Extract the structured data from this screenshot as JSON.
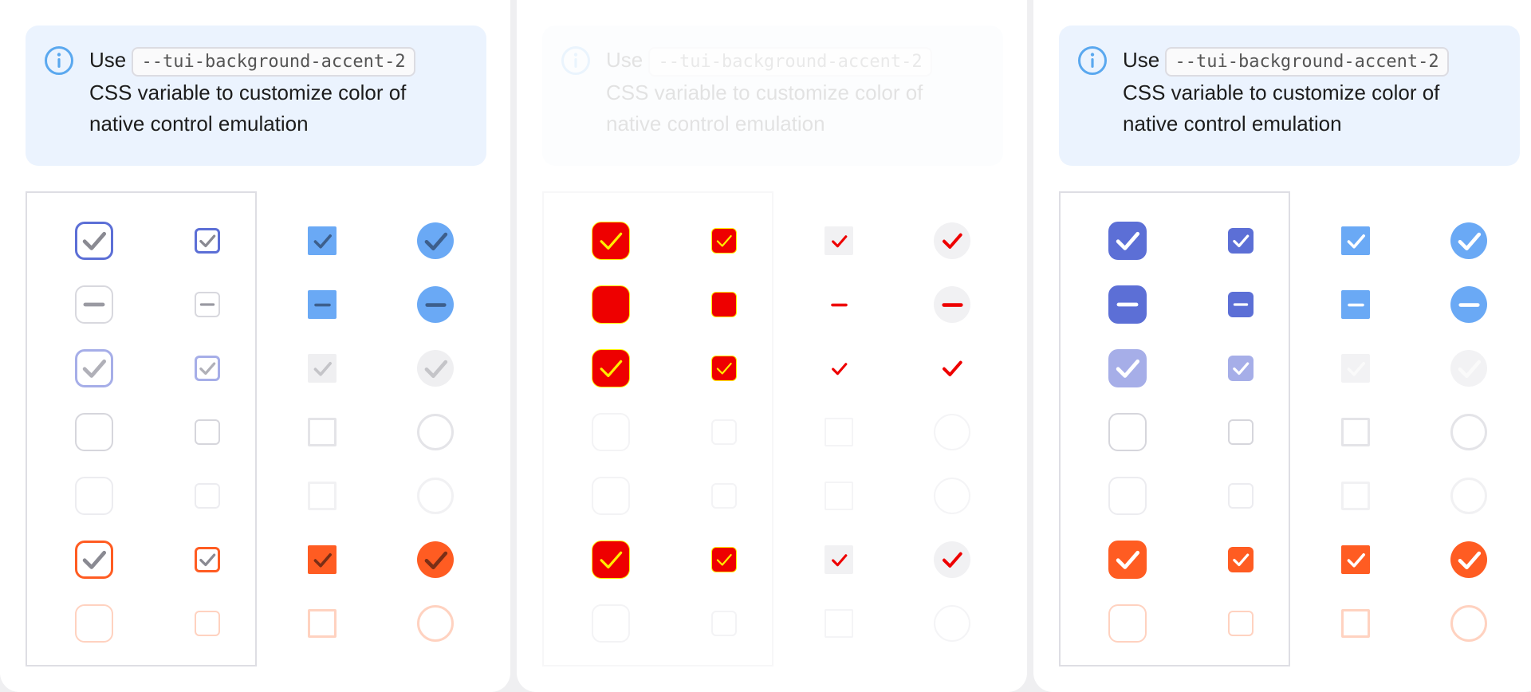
{
  "notice": {
    "prefix": "Use",
    "code": "--tui-background-accent-2",
    "line2": "CSS variable to customize color of",
    "line3": "native control emulation"
  },
  "icons": {
    "info": "info-circle-icon",
    "check": "check-icon",
    "dash": "dash-icon"
  },
  "colors": {
    "primary": "#5c6fd6",
    "primary_light": "#a6aee8",
    "accent": "#ff5c22",
    "accent_faint": "#ffd2c0",
    "blue": "#6aa9f5",
    "neutral": "#e4e4e8",
    "notice_bg": "#ebf3fe",
    "info_icon": "#5aa8ef",
    "debug_red": "#ee0000",
    "debug_yellow": "#ffee00"
  },
  "panels": [
    {
      "name": "panel-left",
      "mode": "native"
    },
    {
      "name": "panel-middle",
      "mode": "debug"
    },
    {
      "name": "panel-right",
      "mode": "styled"
    }
  ],
  "rows": [
    "checked",
    "indeterminate",
    "checked-disabled",
    "unchecked",
    "unchecked-disabled",
    "invalid-checked",
    "invalid-unchecked"
  ],
  "columns": [
    "checkbox-large",
    "checkbox-small",
    "square",
    "circle"
  ]
}
